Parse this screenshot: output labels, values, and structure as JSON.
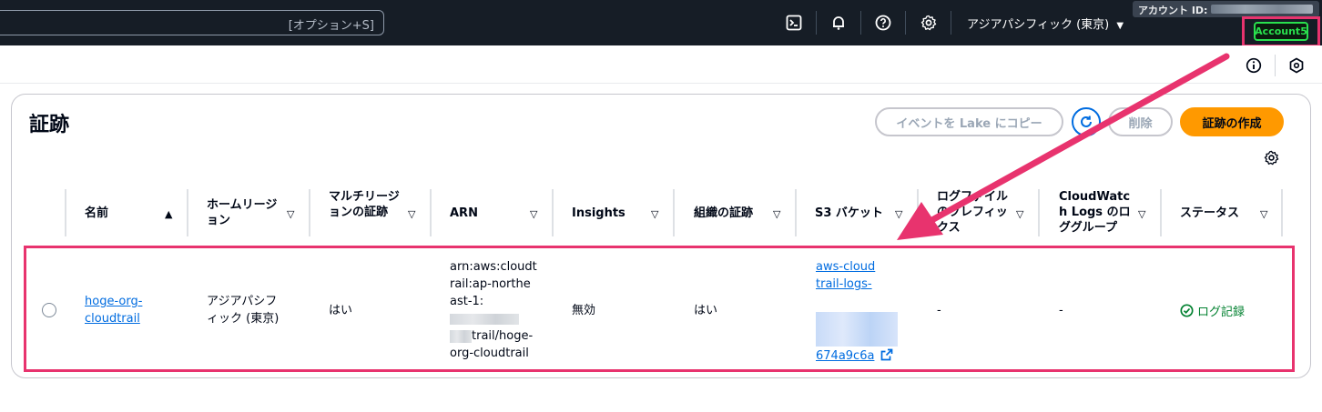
{
  "topbar": {
    "search_shortcut": "[オプション+S]",
    "region": "アジアパシフィック (東京)",
    "account_id_label": "アカウント ID:",
    "account_badge": "Account5",
    "icons": [
      "cloudshell-icon",
      "bell-icon",
      "help-icon",
      "gear-icon"
    ]
  },
  "page": {
    "title": "証跡"
  },
  "actions": {
    "copy_to_lake": "イベントを Lake にコピー",
    "delete": "削除",
    "create": "証跡の作成"
  },
  "table": {
    "columns": [
      {
        "label": "名前",
        "sort": "ascending"
      },
      {
        "label": "ホームリージョン",
        "sort": "none"
      },
      {
        "label": "マルチリージョンの証跡",
        "sort": "none"
      },
      {
        "label": "ARN",
        "sort": "none"
      },
      {
        "label": "Insights",
        "sort": "none"
      },
      {
        "label": "組織の証跡",
        "sort": "none"
      },
      {
        "label": "S3 バケット",
        "sort": "none"
      },
      {
        "label": "ログファイルのプレフィックス",
        "sort": "none"
      },
      {
        "label": "CloudWatch Logs のロググループ",
        "sort": "none"
      },
      {
        "label": "ステータス",
        "sort": "none"
      }
    ],
    "rows": [
      {
        "name": "hoge-org-cloudtrail",
        "home_region": "アジアパシフィック (東京)",
        "multi_region": "はい",
        "arn_prefix": "arn:aws:cloudtrail:ap-northeast-1:",
        "arn_suffix": "trail/hoge-org-cloudtrail",
        "insights": "無効",
        "org_trail": "はい",
        "s3_bucket_prefix": "aws-cloudtrail-logs-",
        "s3_bucket_suffix": "674a9c6a",
        "log_prefix": "-",
        "cloudwatch_log_group": "-",
        "status": "ログ記録"
      }
    ]
  },
  "colors": {
    "accent_link": "#006ce0",
    "primary_button": "#ff9900",
    "status_ok": "#00802f",
    "annotation": "#e8336e"
  }
}
